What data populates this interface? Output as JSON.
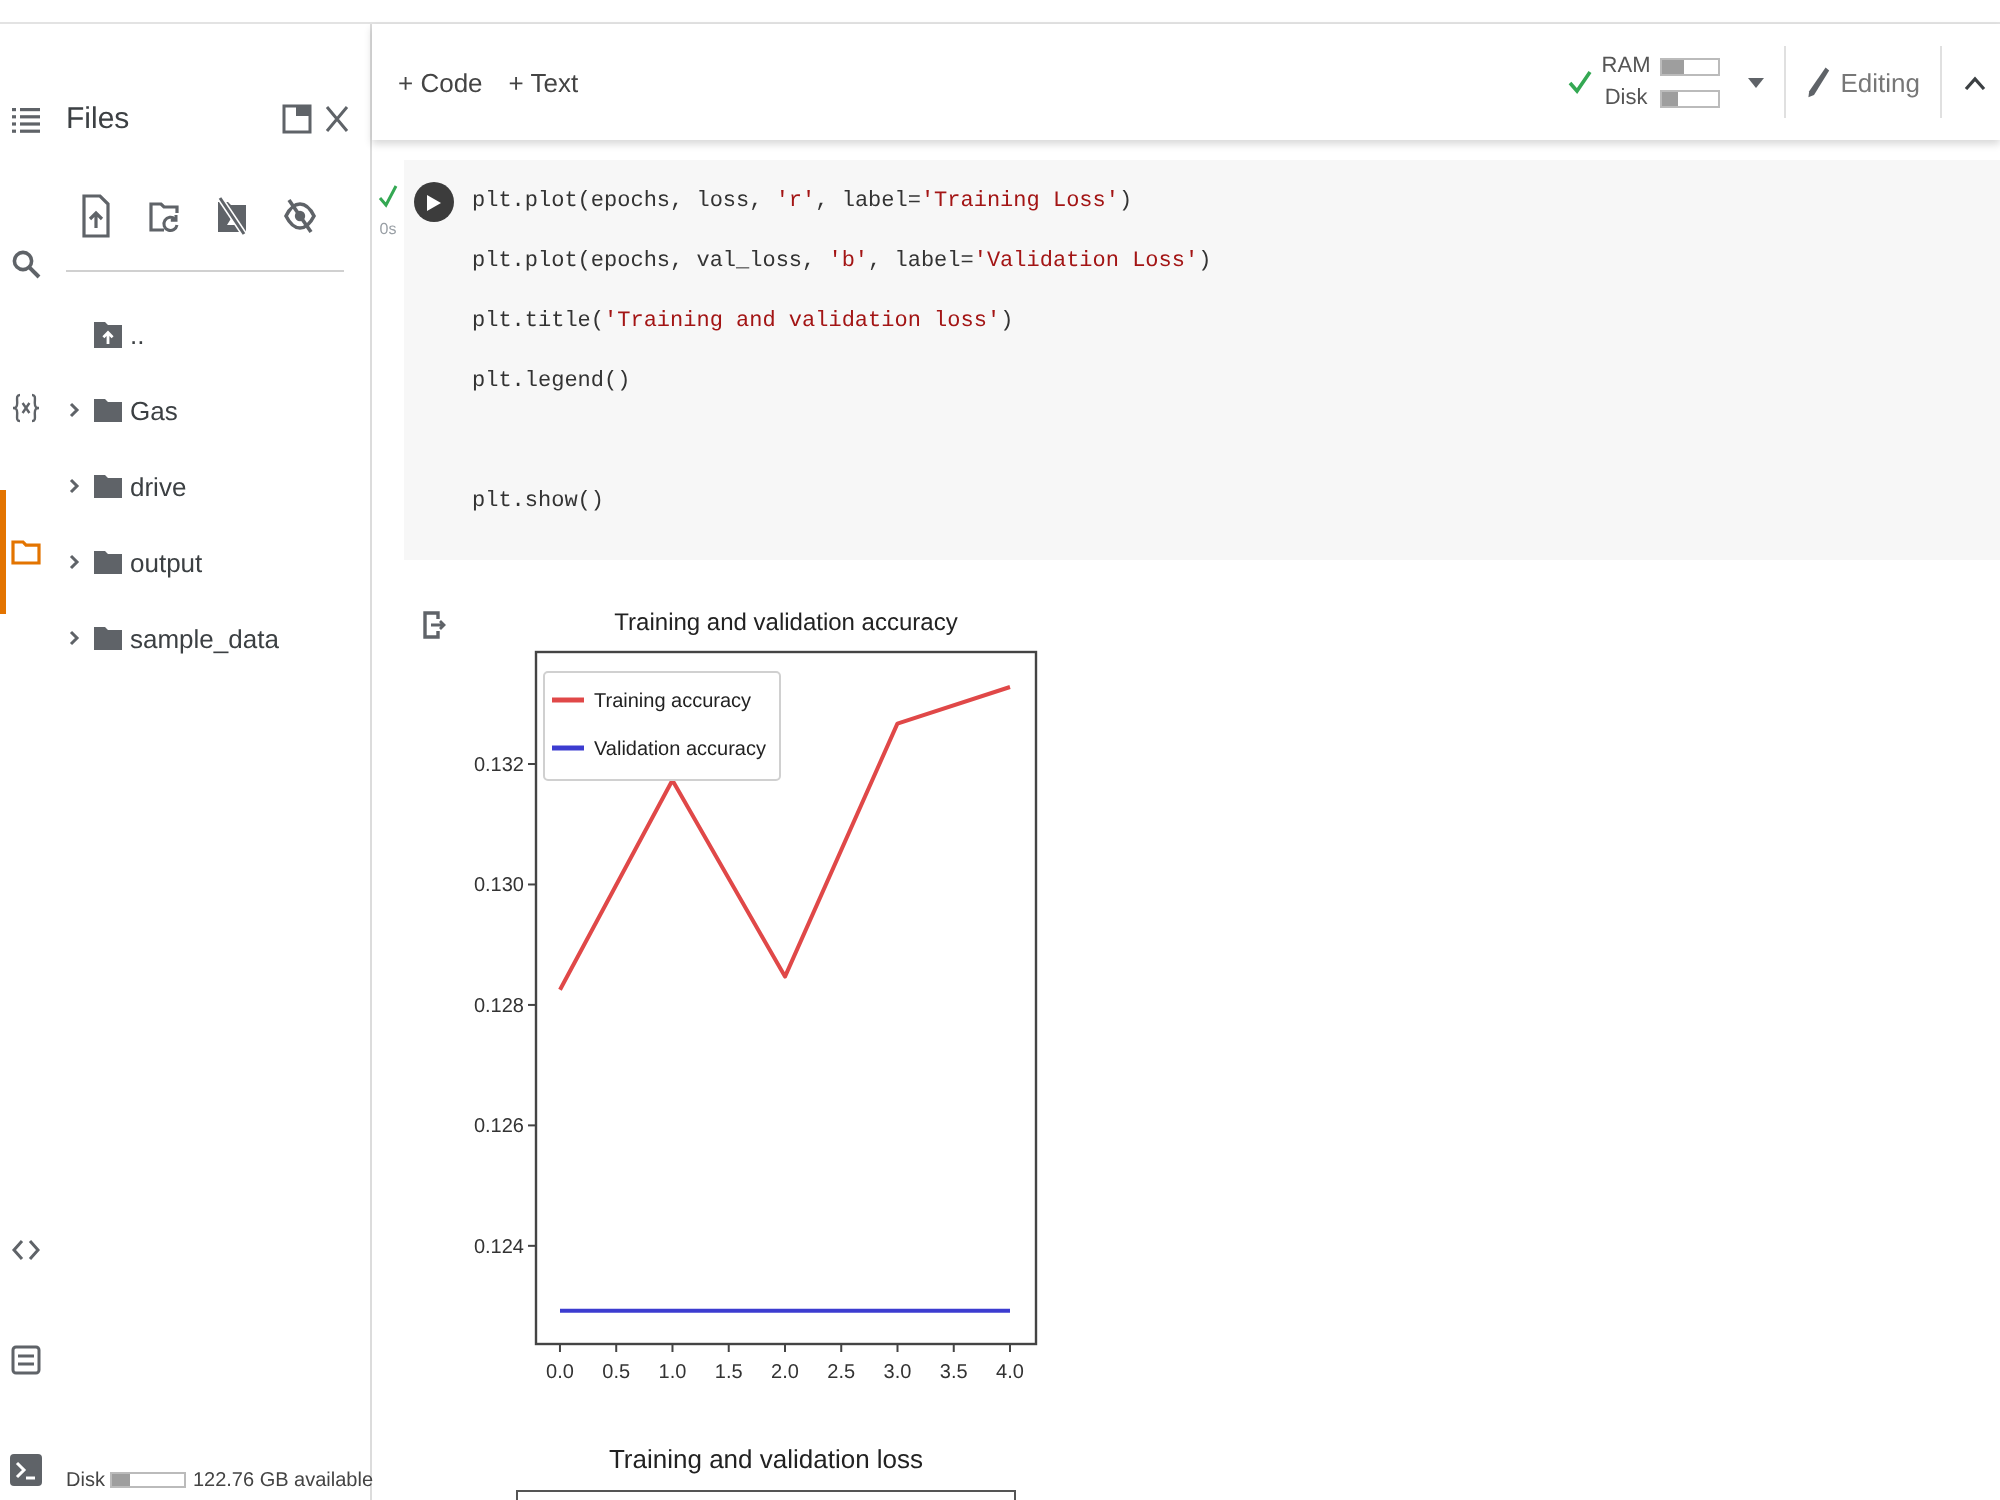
{
  "nav_rail": {
    "items": [
      {
        "kind": "contents",
        "selected": false
      },
      {
        "kind": "search",
        "selected": false
      },
      {
        "kind": "variables",
        "selected": false
      },
      {
        "kind": "files",
        "selected": true
      }
    ],
    "bottom_items": [
      {
        "kind": "snippets"
      },
      {
        "kind": "command_palette"
      },
      {
        "kind": "terminal"
      }
    ]
  },
  "files_panel": {
    "title": "Files",
    "tree": [
      {
        "kind": "parent",
        "name": ".."
      },
      {
        "kind": "folder",
        "name": "Gas",
        "expanded": false
      },
      {
        "kind": "folder",
        "name": "drive",
        "expanded": false
      },
      {
        "kind": "folder",
        "name": "output",
        "expanded": false
      },
      {
        "kind": "folder",
        "name": "sample_data",
        "expanded": false
      }
    ],
    "disk": {
      "label": "Disk",
      "level": 0.25,
      "text": "122.76 GB available"
    }
  },
  "toolbar": {
    "insert_buttons": [
      "+ Code",
      "+ Text"
    ],
    "runtime": {
      "connected": true,
      "meters": [
        {
          "label": "RAM",
          "level": 0.37
        },
        {
          "label": "Disk",
          "level": 0.27
        }
      ]
    },
    "mode": "Editing"
  },
  "code_cell": {
    "finished": true,
    "exec_time": "0s",
    "lines": [
      {
        "kind": "code",
        "segments": [
          {
            "kind": "plain",
            "text": "plt.plot(epochs, loss, "
          },
          {
            "kind": "string",
            "text": "'r'"
          },
          {
            "kind": "plain",
            "text": ", label="
          },
          {
            "kind": "string",
            "text": "'Training Loss'"
          },
          {
            "kind": "plain",
            "text": ")"
          }
        ]
      },
      {
        "kind": "code",
        "segments": [
          {
            "kind": "plain",
            "text": "plt.plot(epochs, val_loss, "
          },
          {
            "kind": "string",
            "text": "'b'"
          },
          {
            "kind": "plain",
            "text": ", label="
          },
          {
            "kind": "string",
            "text": "'Validation Loss'"
          },
          {
            "kind": "plain",
            "text": ")"
          }
        ]
      },
      {
        "kind": "code",
        "segments": [
          {
            "kind": "plain",
            "text": "plt.title("
          },
          {
            "kind": "string",
            "text": "'Training and validation loss'"
          },
          {
            "kind": "plain",
            "text": ")"
          }
        ]
      },
      {
        "kind": "code",
        "segments": [
          {
            "kind": "plain",
            "text": "plt.legend()"
          }
        ]
      },
      {
        "kind": "blank"
      },
      {
        "kind": "code",
        "segments": [
          {
            "kind": "plain",
            "text": "plt.show()"
          }
        ]
      }
    ]
  },
  "output": {
    "figures": [
      {
        "chart_data": {
          "type": "line",
          "title": "Training and validation accuracy",
          "legend": "upper left",
          "x": [
            0,
            1,
            2,
            3,
            4
          ],
          "series": [
            {
              "name": "Training accuracy",
              "color": "#e04848",
              "values": [
                0.12825,
                0.13173,
                0.12847,
                0.13267,
                0.13328
              ]
            },
            {
              "name": "Validation accuracy",
              "color": "#3c3cd0",
              "values": [
                0.12292,
                0.12292,
                0.12292,
                0.12292,
                0.12292
              ]
            }
          ],
          "xlim": [
            -0.213,
            4.231
          ],
          "ylim": [
            0.12237,
            0.13386
          ],
          "xticks": [
            {
              "value": 0,
              "label": "0.0"
            },
            {
              "value": 0.5,
              "label": "0.5"
            },
            {
              "value": 1,
              "label": "1.0"
            },
            {
              "value": 1.5,
              "label": "1.5"
            },
            {
              "value": 2,
              "label": "2.0"
            },
            {
              "value": 2.5,
              "label": "2.5"
            },
            {
              "value": 3,
              "label": "3.0"
            },
            {
              "value": 3.5,
              "label": "3.5"
            },
            {
              "value": 4,
              "label": "4.0"
            }
          ],
          "yticks": [
            {
              "value": 0.124,
              "label": "0.124"
            },
            {
              "value": 0.126,
              "label": "0.126"
            },
            {
              "value": 0.128,
              "label": "0.128"
            },
            {
              "value": 0.13,
              "label": "0.130"
            },
            {
              "value": 0.132,
              "label": "0.132"
            }
          ]
        }
      },
      {
        "title": "Training and validation loss"
      }
    ]
  }
}
